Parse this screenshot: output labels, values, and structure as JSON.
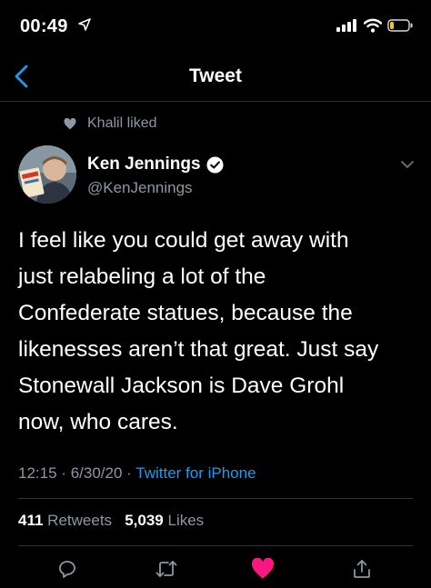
{
  "status_bar": {
    "time": "00:49"
  },
  "nav": {
    "title": "Tweet"
  },
  "social_context": {
    "text": "Khalil liked"
  },
  "author": {
    "name": "Ken Jennings",
    "handle": "@KenJennings"
  },
  "tweet": {
    "lines": [
      "I feel like you could get away with",
      "just relabeling a lot of the",
      "Confederate statues, because the",
      "likenesses aren’t that great. Just say",
      "Stonewall Jackson is Dave Grohl",
      "now, who cares."
    ],
    "time": "12:15",
    "date": "6/30/20",
    "separator": "·",
    "source": "Twitter for iPhone"
  },
  "stats": {
    "retweets_count": "411",
    "retweets_label": "Retweets",
    "likes_count": "5,039",
    "likes_label": "Likes"
  },
  "colors": {
    "accent": "#1d9bf0",
    "like": "#f91880",
    "muted": "#8b98a5",
    "background": "#000000"
  }
}
